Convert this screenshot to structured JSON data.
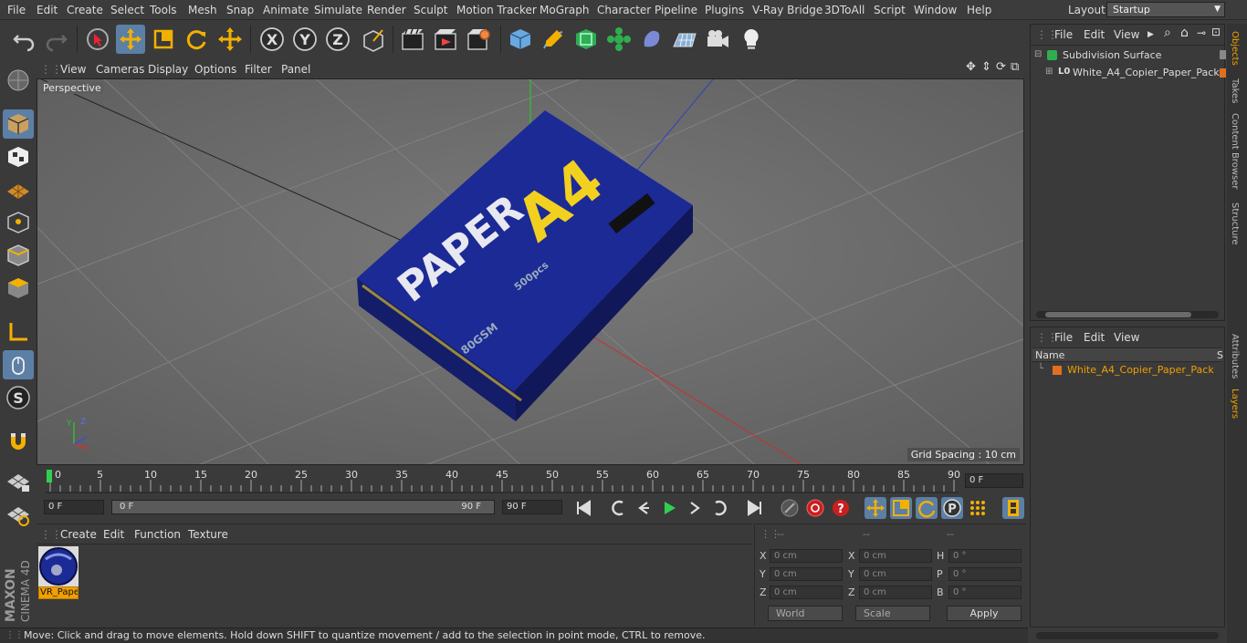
{
  "menu": [
    "File",
    "Edit",
    "Create",
    "Select",
    "Tools",
    "Mesh",
    "Snap",
    "Animate",
    "Simulate",
    "Render",
    "Sculpt",
    "Motion Tracker",
    "MoGraph",
    "Character",
    "Pipeline",
    "Plugins",
    "V-Ray Bridge",
    "3DToAll",
    "Script",
    "Window",
    "Help"
  ],
  "layout": {
    "label": "Layout:",
    "value": "Startup"
  },
  "toolbar_icons": [
    "undo-icon",
    "redo-icon",
    "live-select-icon",
    "move-icon",
    "scale-icon",
    "rotate-icon",
    "recent-tools-icon",
    "x-axis-icon",
    "y-axis-icon",
    "z-axis-icon",
    "coordinate-system-icon",
    "render-view-icon",
    "render-picture-viewer-icon",
    "render-settings-icon",
    "cube-icon",
    "pen-icon",
    "subdivision-icon",
    "cloner-icon",
    "deformer-icon",
    "floor-icon",
    "camera-icon",
    "light-icon"
  ],
  "viewport": {
    "menu": [
      "View",
      "Cameras",
      "Display",
      "Options",
      "Filter",
      "Panel"
    ],
    "label": "Perspective",
    "grid_spacing": "Grid Spacing : 10 cm",
    "box_text": {
      "paper": "PAPER",
      "a4": "A4",
      "gsm": "80GSM",
      "sheets": "500pcs"
    }
  },
  "timeline": {
    "ticks": [
      "0",
      "5",
      "10",
      "15",
      "20",
      "25",
      "30",
      "35",
      "40",
      "45",
      "50",
      "55",
      "60",
      "65",
      "70",
      "75",
      "80",
      "85",
      "90"
    ],
    "current_frame": "0 F"
  },
  "playbar": {
    "start": "0 F",
    "range_start": "0 F",
    "range_end": "90 F",
    "end": "90 F"
  },
  "material_panel": {
    "menu": [
      "Create",
      "Edit",
      "Function",
      "Texture"
    ],
    "material_name": "VR_Paper"
  },
  "coords": {
    "headers": [
      "--",
      "--",
      "--"
    ],
    "rows": [
      {
        "l1": "X",
        "v1": "0 cm",
        "l2": "X",
        "v2": "0 cm",
        "l3": "H",
        "v3": "0 °"
      },
      {
        "l1": "Y",
        "v1": "0 cm",
        "l2": "Y",
        "v2": "0 cm",
        "l3": "P",
        "v3": "0 °"
      },
      {
        "l1": "Z",
        "v1": "0 cm",
        "l2": "Z",
        "v2": "0 cm",
        "l3": "B",
        "v3": "0 °"
      }
    ],
    "world": "World",
    "scale": "Scale",
    "apply": "Apply"
  },
  "status": "Move: Click and drag to move elements. Hold down SHIFT to quantize movement / add to the selection in point mode, CTRL to remove.",
  "objects_panel": {
    "menu": [
      "File",
      "Edit",
      "View"
    ],
    "items": [
      "Subdivision Surface",
      "White_A4_Copier_Paper_Pack"
    ]
  },
  "layers_panel": {
    "menu": [
      "File",
      "Edit",
      "View"
    ],
    "col_name": "Name",
    "col_s": "S",
    "item": "White_A4_Copier_Paper_Pack"
  },
  "right_tabs": [
    "Objects",
    "Takes",
    "Content Browser",
    "Structure",
    "Attributes",
    "Layers"
  ],
  "logo": {
    "maxon": "MAXON",
    "cinema": "CINEMA 4D"
  },
  "colors": {
    "accent": "#f0a000",
    "active": "#5c7fa6",
    "box": "#1b1f8a"
  }
}
